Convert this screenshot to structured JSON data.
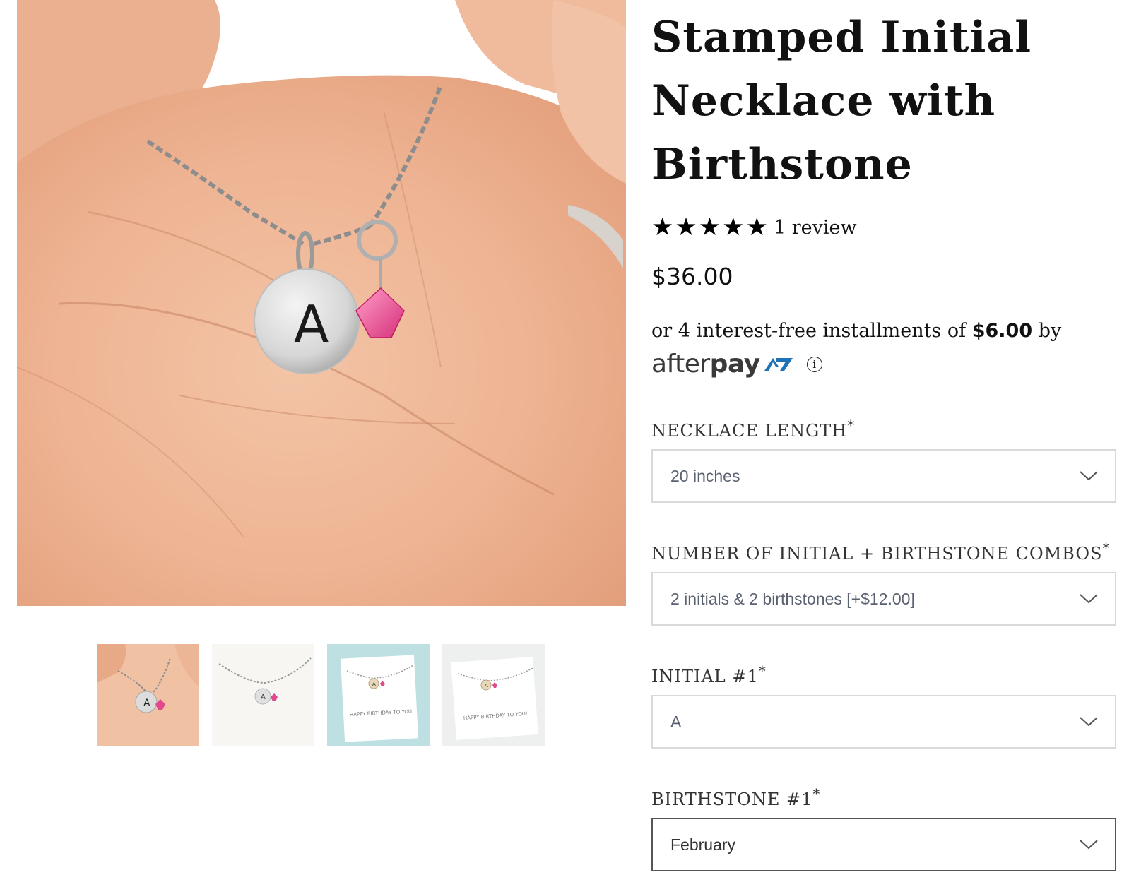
{
  "product": {
    "title_line1": "Stamped Initial",
    "title_line2": "Necklace with",
    "title_line3": "Birthstone",
    "rating": 5,
    "stars": [
      "★",
      "★",
      "★",
      "★",
      "★"
    ],
    "review_count": "1 review",
    "price": "$36.00"
  },
  "afterpay": {
    "text_before": "or 4 interest-free installments of ",
    "installment": "$6.00",
    "text_after": " by",
    "logo_after": "after",
    "logo_pay": "pay",
    "info_symbol": "i",
    "brand_color": "#1d72b8"
  },
  "gallery": {
    "main_pendant_letter": "A",
    "thumbnails": [
      {
        "name": "thumb-hand",
        "letter": "A"
      },
      {
        "name": "thumb-white",
        "letter": "A"
      },
      {
        "name": "thumb-card-blue",
        "letter": "A",
        "card_text": "HAPPY BIRTHDAY TO YOU!"
      },
      {
        "name": "thumb-card-white",
        "letter": "A",
        "card_text": "HAPPY BIRTHDAY TO YOU!"
      }
    ]
  },
  "options": [
    {
      "label": "NECKLACE LENGTH",
      "required": "*",
      "value": "20 inches"
    },
    {
      "label": "NUMBER OF INITIAL + BIRTHSTONE COMBOS",
      "required": "*",
      "value": "2 initials & 2 birthstones [+$12.00]"
    },
    {
      "label": "INITIAL #1",
      "required": "*",
      "value": "A"
    },
    {
      "label": "BIRTHSTONE #1",
      "required": "*",
      "value": "February"
    }
  ]
}
